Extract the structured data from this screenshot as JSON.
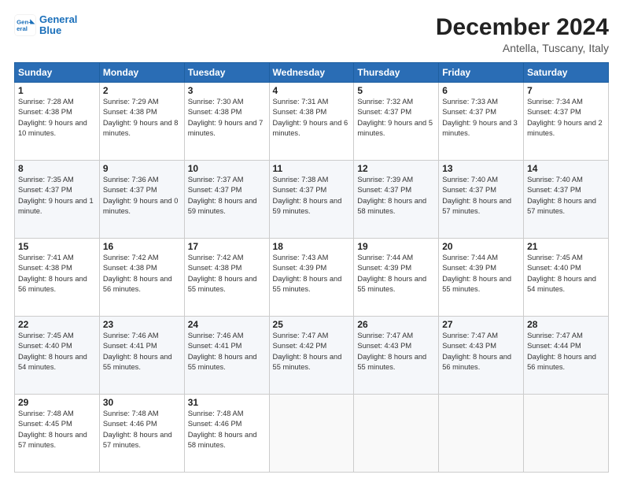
{
  "header": {
    "logo_line1": "General",
    "logo_line2": "Blue",
    "title": "December 2024",
    "subtitle": "Antella, Tuscany, Italy"
  },
  "weekdays": [
    "Sunday",
    "Monday",
    "Tuesday",
    "Wednesday",
    "Thursday",
    "Friday",
    "Saturday"
  ],
  "weeks": [
    [
      {
        "day": "1",
        "sunrise": "7:28 AM",
        "sunset": "4:38 PM",
        "daylight": "9 hours and 10 minutes."
      },
      {
        "day": "2",
        "sunrise": "7:29 AM",
        "sunset": "4:38 PM",
        "daylight": "9 hours and 8 minutes."
      },
      {
        "day": "3",
        "sunrise": "7:30 AM",
        "sunset": "4:38 PM",
        "daylight": "9 hours and 7 minutes."
      },
      {
        "day": "4",
        "sunrise": "7:31 AM",
        "sunset": "4:38 PM",
        "daylight": "9 hours and 6 minutes."
      },
      {
        "day": "5",
        "sunrise": "7:32 AM",
        "sunset": "4:37 PM",
        "daylight": "9 hours and 5 minutes."
      },
      {
        "day": "6",
        "sunrise": "7:33 AM",
        "sunset": "4:37 PM",
        "daylight": "9 hours and 3 minutes."
      },
      {
        "day": "7",
        "sunrise": "7:34 AM",
        "sunset": "4:37 PM",
        "daylight": "9 hours and 2 minutes."
      }
    ],
    [
      {
        "day": "8",
        "sunrise": "7:35 AM",
        "sunset": "4:37 PM",
        "daylight": "9 hours and 1 minute."
      },
      {
        "day": "9",
        "sunrise": "7:36 AM",
        "sunset": "4:37 PM",
        "daylight": "9 hours and 0 minutes."
      },
      {
        "day": "10",
        "sunrise": "7:37 AM",
        "sunset": "4:37 PM",
        "daylight": "8 hours and 59 minutes."
      },
      {
        "day": "11",
        "sunrise": "7:38 AM",
        "sunset": "4:37 PM",
        "daylight": "8 hours and 59 minutes."
      },
      {
        "day": "12",
        "sunrise": "7:39 AM",
        "sunset": "4:37 PM",
        "daylight": "8 hours and 58 minutes."
      },
      {
        "day": "13",
        "sunrise": "7:40 AM",
        "sunset": "4:37 PM",
        "daylight": "8 hours and 57 minutes."
      },
      {
        "day": "14",
        "sunrise": "7:40 AM",
        "sunset": "4:37 PM",
        "daylight": "8 hours and 57 minutes."
      }
    ],
    [
      {
        "day": "15",
        "sunrise": "7:41 AM",
        "sunset": "4:38 PM",
        "daylight": "8 hours and 56 minutes."
      },
      {
        "day": "16",
        "sunrise": "7:42 AM",
        "sunset": "4:38 PM",
        "daylight": "8 hours and 56 minutes."
      },
      {
        "day": "17",
        "sunrise": "7:42 AM",
        "sunset": "4:38 PM",
        "daylight": "8 hours and 55 minutes."
      },
      {
        "day": "18",
        "sunrise": "7:43 AM",
        "sunset": "4:39 PM",
        "daylight": "8 hours and 55 minutes."
      },
      {
        "day": "19",
        "sunrise": "7:44 AM",
        "sunset": "4:39 PM",
        "daylight": "8 hours and 55 minutes."
      },
      {
        "day": "20",
        "sunrise": "7:44 AM",
        "sunset": "4:39 PM",
        "daylight": "8 hours and 55 minutes."
      },
      {
        "day": "21",
        "sunrise": "7:45 AM",
        "sunset": "4:40 PM",
        "daylight": "8 hours and 54 minutes."
      }
    ],
    [
      {
        "day": "22",
        "sunrise": "7:45 AM",
        "sunset": "4:40 PM",
        "daylight": "8 hours and 54 minutes."
      },
      {
        "day": "23",
        "sunrise": "7:46 AM",
        "sunset": "4:41 PM",
        "daylight": "8 hours and 55 minutes."
      },
      {
        "day": "24",
        "sunrise": "7:46 AM",
        "sunset": "4:41 PM",
        "daylight": "8 hours and 55 minutes."
      },
      {
        "day": "25",
        "sunrise": "7:47 AM",
        "sunset": "4:42 PM",
        "daylight": "8 hours and 55 minutes."
      },
      {
        "day": "26",
        "sunrise": "7:47 AM",
        "sunset": "4:43 PM",
        "daylight": "8 hours and 55 minutes."
      },
      {
        "day": "27",
        "sunrise": "7:47 AM",
        "sunset": "4:43 PM",
        "daylight": "8 hours and 56 minutes."
      },
      {
        "day": "28",
        "sunrise": "7:47 AM",
        "sunset": "4:44 PM",
        "daylight": "8 hours and 56 minutes."
      }
    ],
    [
      {
        "day": "29",
        "sunrise": "7:48 AM",
        "sunset": "4:45 PM",
        "daylight": "8 hours and 57 minutes."
      },
      {
        "day": "30",
        "sunrise": "7:48 AM",
        "sunset": "4:46 PM",
        "daylight": "8 hours and 57 minutes."
      },
      {
        "day": "31",
        "sunrise": "7:48 AM",
        "sunset": "4:46 PM",
        "daylight": "8 hours and 58 minutes."
      },
      null,
      null,
      null,
      null
    ]
  ],
  "labels": {
    "sunrise": "Sunrise:",
    "sunset": "Sunset:",
    "daylight": "Daylight:"
  }
}
